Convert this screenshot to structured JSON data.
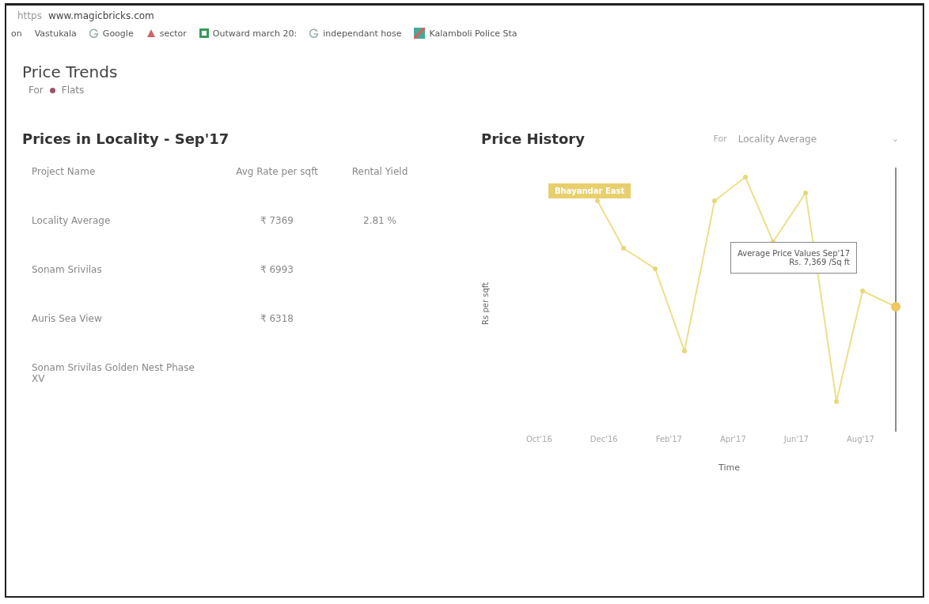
{
  "address_bar": {
    "scheme": "https",
    "url": "www.magicbricks.com"
  },
  "bookmarks": [
    {
      "label": "on",
      "kind": "plain"
    },
    {
      "label": "Vastukala",
      "kind": "plain"
    },
    {
      "label": "Google",
      "kind": "google"
    },
    {
      "label": "sector",
      "kind": "site"
    },
    {
      "label": "Outward march 20:",
      "kind": "sheet"
    },
    {
      "label": "independant hose",
      "kind": "google"
    },
    {
      "label": "Kalamboli Police Sta",
      "kind": "map"
    }
  ],
  "header": {
    "title": "Price Trends",
    "for_label": "For",
    "filter": {
      "label": "Flats",
      "color": "#a0526a"
    }
  },
  "prices": {
    "title": "Prices in Locality - Sep'17",
    "columns": [
      "Project Name",
      "Avg Rate per sqft",
      "Rental Yield"
    ],
    "rows": [
      {
        "name": "Locality Average",
        "rate": "₹ 7369",
        "yield": "2.81 %"
      },
      {
        "name": "Sonam Srivilas",
        "rate": "₹ 6993"
      },
      {
        "name": "Auris Sea View",
        "rate": "₹ 6318"
      },
      {
        "name": "Sonam Srivilas Golden Nest Phase XV"
      }
    ]
  },
  "history": {
    "title": "Price History",
    "for_label": "For",
    "select": "Locality Average",
    "caret": "⌄",
    "tag": "Bhayandar East",
    "ylabel": "Rs per sqft",
    "xlabel": "Time",
    "xlabels": [
      "Oct'16",
      "Dec'16",
      "Feb'17",
      "Apr'17",
      "Jun'17",
      "Aug'17"
    ],
    "tooltip": {
      "title": "Average Price Values  Sep'17",
      "value": "Rs. 7,369 /Sq ft"
    }
  }
}
